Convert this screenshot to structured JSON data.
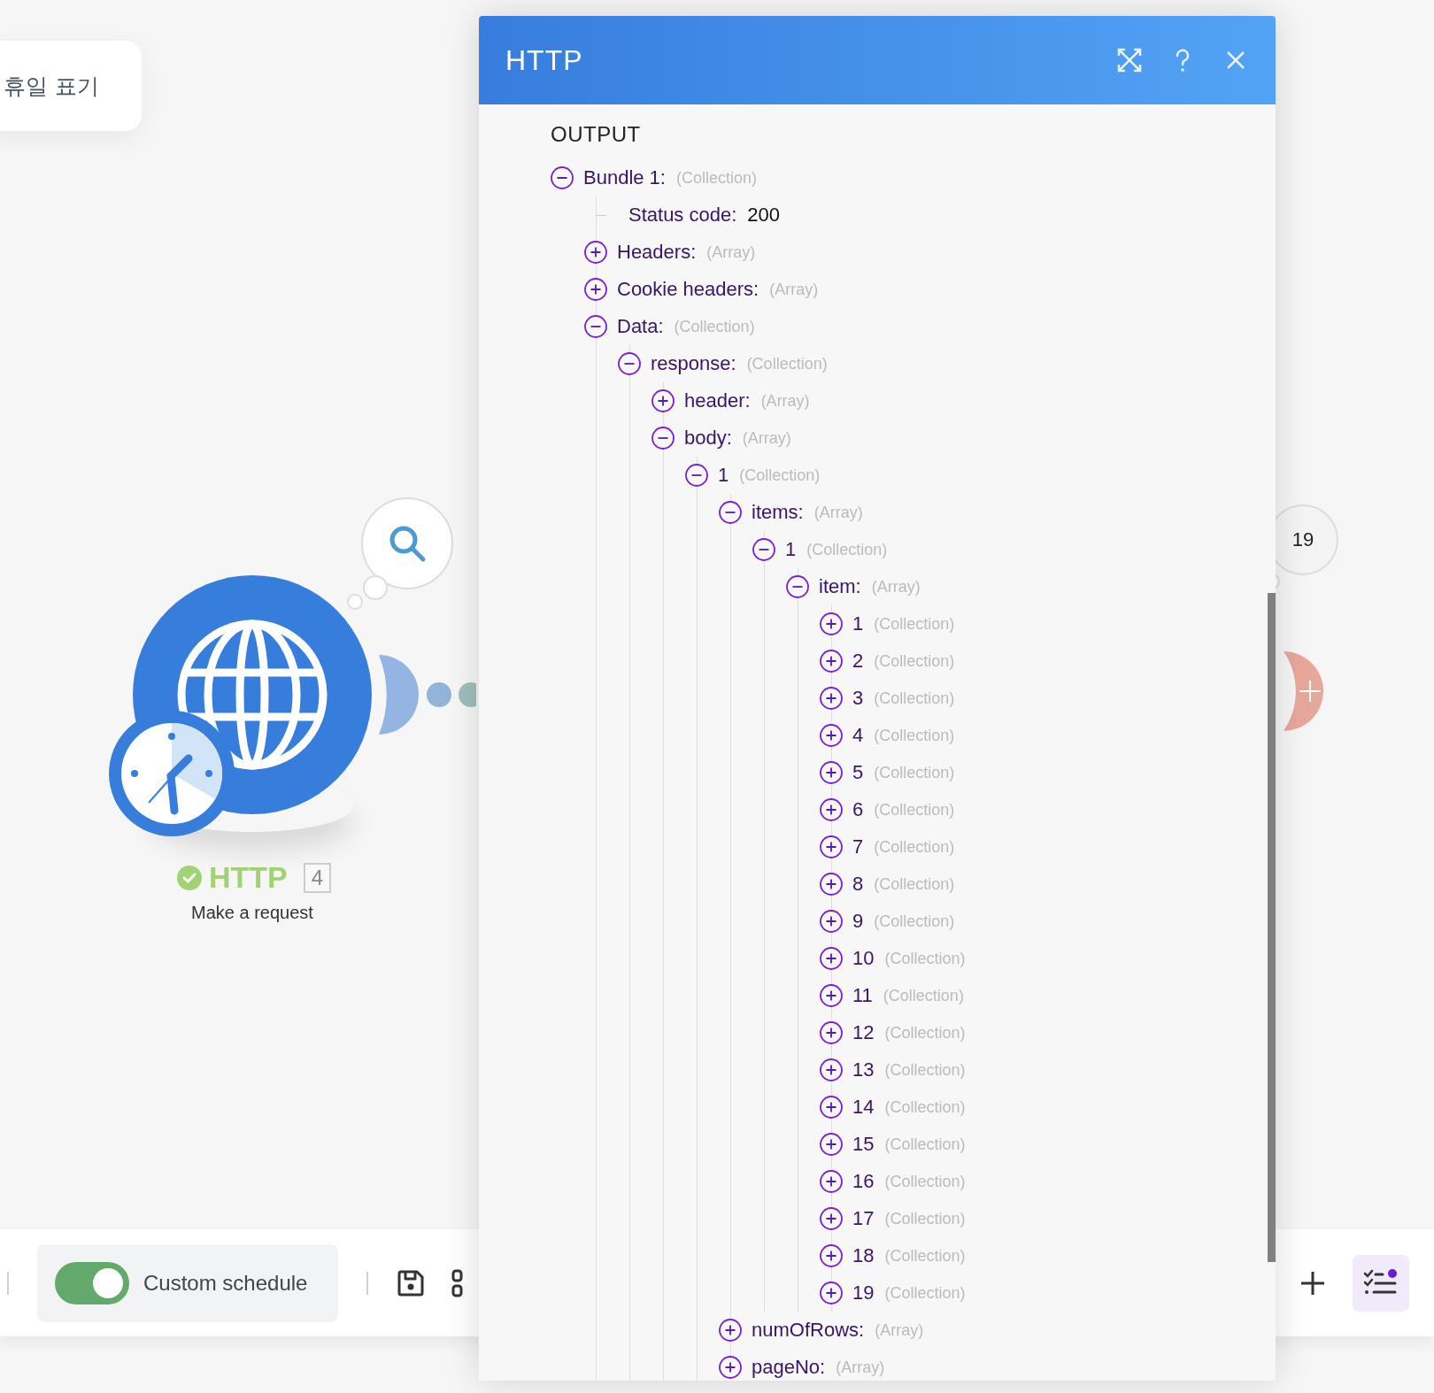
{
  "canvas": {
    "note_card": {
      "text": "휴일 표기"
    },
    "module": {
      "title": "HTTP",
      "success": true,
      "count": "4",
      "subtitle": "Make a request"
    },
    "next_module": {
      "count": "19"
    }
  },
  "dialog": {
    "title": "HTTP",
    "section": "OUTPUT",
    "tree": [
      {
        "kind": "node",
        "label": "Bundle 1:",
        "type": "(Collection)",
        "expanded": true,
        "children": [
          {
            "kind": "value",
            "label": "Status code:",
            "value": "200"
          },
          {
            "kind": "node",
            "label": "Headers:",
            "type": "(Array)",
            "expanded": false
          },
          {
            "kind": "node",
            "label": "Cookie headers:",
            "type": "(Array)",
            "expanded": false
          },
          {
            "kind": "node",
            "label": "Data:",
            "type": "(Collection)",
            "expanded": true,
            "children": [
              {
                "kind": "node",
                "label": "response:",
                "type": "(Collection)",
                "expanded": true,
                "children": [
                  {
                    "kind": "node",
                    "label": "header:",
                    "type": "(Array)",
                    "expanded": false
                  },
                  {
                    "kind": "node",
                    "label": "body:",
                    "type": "(Array)",
                    "expanded": true,
                    "children": [
                      {
                        "kind": "node",
                        "label": "1",
                        "type": "(Collection)",
                        "expanded": true,
                        "children": [
                          {
                            "kind": "node",
                            "label": "items:",
                            "type": "(Array)",
                            "expanded": true,
                            "children": [
                              {
                                "kind": "node",
                                "label": "1",
                                "type": "(Collection)",
                                "expanded": true,
                                "children": [
                                  {
                                    "kind": "node",
                                    "label": "item:",
                                    "type": "(Array)",
                                    "expanded": true,
                                    "children": [
                                      {
                                        "kind": "node",
                                        "label": "1",
                                        "type": "(Collection)",
                                        "expanded": false
                                      },
                                      {
                                        "kind": "node",
                                        "label": "2",
                                        "type": "(Collection)",
                                        "expanded": false
                                      },
                                      {
                                        "kind": "node",
                                        "label": "3",
                                        "type": "(Collection)",
                                        "expanded": false
                                      },
                                      {
                                        "kind": "node",
                                        "label": "4",
                                        "type": "(Collection)",
                                        "expanded": false
                                      },
                                      {
                                        "kind": "node",
                                        "label": "5",
                                        "type": "(Collection)",
                                        "expanded": false
                                      },
                                      {
                                        "kind": "node",
                                        "label": "6",
                                        "type": "(Collection)",
                                        "expanded": false
                                      },
                                      {
                                        "kind": "node",
                                        "label": "7",
                                        "type": "(Collection)",
                                        "expanded": false
                                      },
                                      {
                                        "kind": "node",
                                        "label": "8",
                                        "type": "(Collection)",
                                        "expanded": false
                                      },
                                      {
                                        "kind": "node",
                                        "label": "9",
                                        "type": "(Collection)",
                                        "expanded": false
                                      },
                                      {
                                        "kind": "node",
                                        "label": "10",
                                        "type": "(Collection)",
                                        "expanded": false
                                      },
                                      {
                                        "kind": "node",
                                        "label": "11",
                                        "type": "(Collection)",
                                        "expanded": false
                                      },
                                      {
                                        "kind": "node",
                                        "label": "12",
                                        "type": "(Collection)",
                                        "expanded": false
                                      },
                                      {
                                        "kind": "node",
                                        "label": "13",
                                        "type": "(Collection)",
                                        "expanded": false
                                      },
                                      {
                                        "kind": "node",
                                        "label": "14",
                                        "type": "(Collection)",
                                        "expanded": false
                                      },
                                      {
                                        "kind": "node",
                                        "label": "15",
                                        "type": "(Collection)",
                                        "expanded": false
                                      },
                                      {
                                        "kind": "node",
                                        "label": "16",
                                        "type": "(Collection)",
                                        "expanded": false
                                      },
                                      {
                                        "kind": "node",
                                        "label": "17",
                                        "type": "(Collection)",
                                        "expanded": false
                                      },
                                      {
                                        "kind": "node",
                                        "label": "18",
                                        "type": "(Collection)",
                                        "expanded": false
                                      },
                                      {
                                        "kind": "node",
                                        "label": "19",
                                        "type": "(Collection)",
                                        "expanded": false
                                      }
                                    ]
                                  }
                                ]
                              }
                            ]
                          },
                          {
                            "kind": "node",
                            "label": "numOfRows:",
                            "type": "(Array)",
                            "expanded": false
                          },
                          {
                            "kind": "node",
                            "label": "pageNo:",
                            "type": "(Array)",
                            "expanded": false
                          }
                        ]
                      }
                    ]
                  }
                ]
              }
            ]
          }
        ]
      }
    ]
  },
  "toolbar": {
    "schedule_toggle": {
      "label": "Custom schedule",
      "on": true
    }
  }
}
